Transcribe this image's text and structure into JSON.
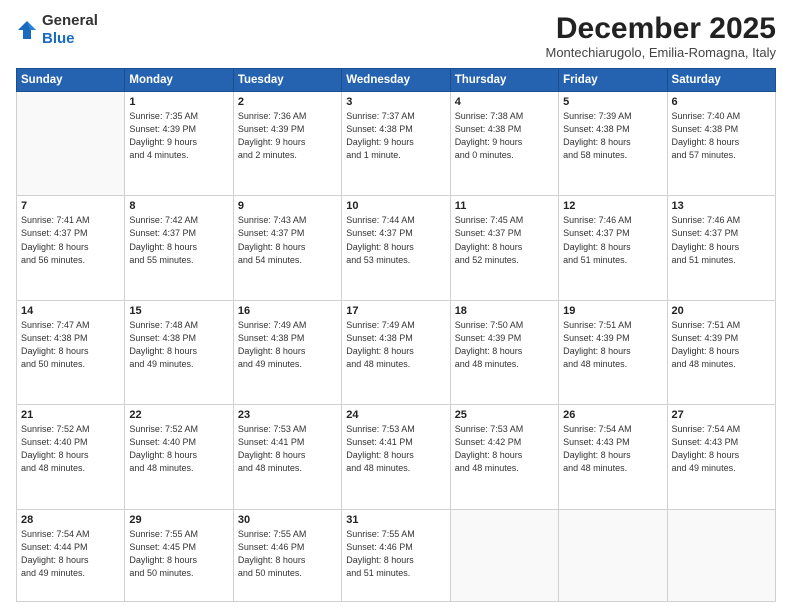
{
  "logo": {
    "text_general": "General",
    "text_blue": "Blue"
  },
  "header": {
    "month": "December 2025",
    "location": "Montechiarugolo, Emilia-Romagna, Italy"
  },
  "weekdays": [
    "Sunday",
    "Monday",
    "Tuesday",
    "Wednesday",
    "Thursday",
    "Friday",
    "Saturday"
  ],
  "weeks": [
    [
      {
        "day": "",
        "empty": true
      },
      {
        "day": "1",
        "sunrise": "7:35 AM",
        "sunset": "4:39 PM",
        "daylight": "9 hours and 4 minutes."
      },
      {
        "day": "2",
        "sunrise": "7:36 AM",
        "sunset": "4:39 PM",
        "daylight": "9 hours and 2 minutes."
      },
      {
        "day": "3",
        "sunrise": "7:37 AM",
        "sunset": "4:38 PM",
        "daylight": "9 hours and 1 minute."
      },
      {
        "day": "4",
        "sunrise": "7:38 AM",
        "sunset": "4:38 PM",
        "daylight": "9 hours and 0 minutes."
      },
      {
        "day": "5",
        "sunrise": "7:39 AM",
        "sunset": "4:38 PM",
        "daylight": "8 hours and 58 minutes."
      },
      {
        "day": "6",
        "sunrise": "7:40 AM",
        "sunset": "4:38 PM",
        "daylight": "8 hours and 57 minutes."
      }
    ],
    [
      {
        "day": "7",
        "sunrise": "7:41 AM",
        "sunset": "4:37 PM",
        "daylight": "8 hours and 56 minutes."
      },
      {
        "day": "8",
        "sunrise": "7:42 AM",
        "sunset": "4:37 PM",
        "daylight": "8 hours and 55 minutes."
      },
      {
        "day": "9",
        "sunrise": "7:43 AM",
        "sunset": "4:37 PM",
        "daylight": "8 hours and 54 minutes."
      },
      {
        "day": "10",
        "sunrise": "7:44 AM",
        "sunset": "4:37 PM",
        "daylight": "8 hours and 53 minutes."
      },
      {
        "day": "11",
        "sunrise": "7:45 AM",
        "sunset": "4:37 PM",
        "daylight": "8 hours and 52 minutes."
      },
      {
        "day": "12",
        "sunrise": "7:46 AM",
        "sunset": "4:37 PM",
        "daylight": "8 hours and 51 minutes."
      },
      {
        "day": "13",
        "sunrise": "7:46 AM",
        "sunset": "4:37 PM",
        "daylight": "8 hours and 51 minutes."
      }
    ],
    [
      {
        "day": "14",
        "sunrise": "7:47 AM",
        "sunset": "4:38 PM",
        "daylight": "8 hours and 50 minutes."
      },
      {
        "day": "15",
        "sunrise": "7:48 AM",
        "sunset": "4:38 PM",
        "daylight": "8 hours and 49 minutes."
      },
      {
        "day": "16",
        "sunrise": "7:49 AM",
        "sunset": "4:38 PM",
        "daylight": "8 hours and 49 minutes."
      },
      {
        "day": "17",
        "sunrise": "7:49 AM",
        "sunset": "4:38 PM",
        "daylight": "8 hours and 48 minutes."
      },
      {
        "day": "18",
        "sunrise": "7:50 AM",
        "sunset": "4:39 PM",
        "daylight": "8 hours and 48 minutes."
      },
      {
        "day": "19",
        "sunrise": "7:51 AM",
        "sunset": "4:39 PM",
        "daylight": "8 hours and 48 minutes."
      },
      {
        "day": "20",
        "sunrise": "7:51 AM",
        "sunset": "4:39 PM",
        "daylight": "8 hours and 48 minutes."
      }
    ],
    [
      {
        "day": "21",
        "sunrise": "7:52 AM",
        "sunset": "4:40 PM",
        "daylight": "8 hours and 48 minutes."
      },
      {
        "day": "22",
        "sunrise": "7:52 AM",
        "sunset": "4:40 PM",
        "daylight": "8 hours and 48 minutes."
      },
      {
        "day": "23",
        "sunrise": "7:53 AM",
        "sunset": "4:41 PM",
        "daylight": "8 hours and 48 minutes."
      },
      {
        "day": "24",
        "sunrise": "7:53 AM",
        "sunset": "4:41 PM",
        "daylight": "8 hours and 48 minutes."
      },
      {
        "day": "25",
        "sunrise": "7:53 AM",
        "sunset": "4:42 PM",
        "daylight": "8 hours and 48 minutes."
      },
      {
        "day": "26",
        "sunrise": "7:54 AM",
        "sunset": "4:43 PM",
        "daylight": "8 hours and 48 minutes."
      },
      {
        "day": "27",
        "sunrise": "7:54 AM",
        "sunset": "4:43 PM",
        "daylight": "8 hours and 49 minutes."
      }
    ],
    [
      {
        "day": "28",
        "sunrise": "7:54 AM",
        "sunset": "4:44 PM",
        "daylight": "8 hours and 49 minutes."
      },
      {
        "day": "29",
        "sunrise": "7:55 AM",
        "sunset": "4:45 PM",
        "daylight": "8 hours and 50 minutes."
      },
      {
        "day": "30",
        "sunrise": "7:55 AM",
        "sunset": "4:46 PM",
        "daylight": "8 hours and 50 minutes."
      },
      {
        "day": "31",
        "sunrise": "7:55 AM",
        "sunset": "4:46 PM",
        "daylight": "8 hours and 51 minutes."
      },
      {
        "day": "",
        "empty": true
      },
      {
        "day": "",
        "empty": true
      },
      {
        "day": "",
        "empty": true
      }
    ]
  ],
  "labels": {
    "sunrise_prefix": "Sunrise: ",
    "sunset_prefix": "Sunset: ",
    "daylight_prefix": "Daylight: "
  }
}
